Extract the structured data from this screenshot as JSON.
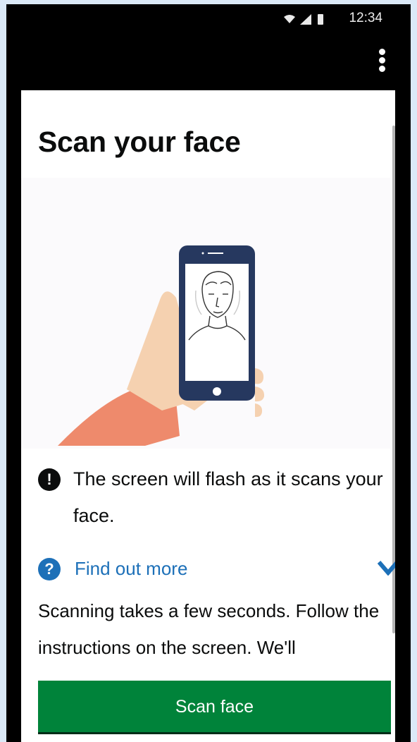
{
  "status_bar": {
    "time": "12:34",
    "icons": [
      "wifi-icon",
      "signal-icon",
      "battery-icon"
    ]
  },
  "app_bar": {
    "menu_icon": "more-vert-icon"
  },
  "page": {
    "title": "Scan your face",
    "illustration": "hand-holding-phone-with-face",
    "notice": {
      "icon": "exclamation-icon",
      "text": "The screen will flash as it scans your face."
    },
    "details": {
      "icon": "question-icon",
      "summary": "Find out more",
      "expand_icon": "chevron-down-icon",
      "body": "Scanning takes a few seconds. Follow the instructions on the screen. We'll"
    },
    "primary_button": "Scan face"
  },
  "colors": {
    "link": "#1d70b8",
    "button": "#00833a",
    "text": "#0b0c0c",
    "skin": "#f5d1b0",
    "sleeve": "#ee8a6c",
    "phone": "#26385f"
  }
}
